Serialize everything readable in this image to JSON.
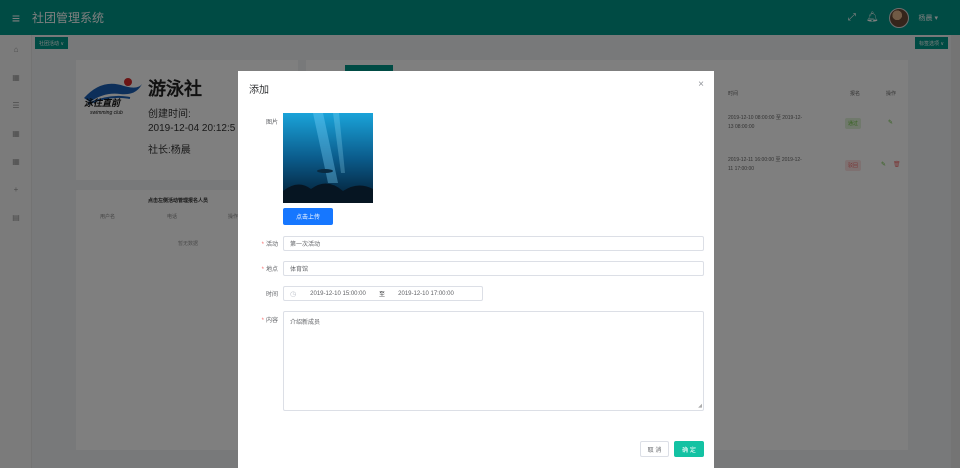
{
  "header": {
    "app_title": "社团管理系统",
    "user_name": "杨晨",
    "user_caret": "▾"
  },
  "tabs": {
    "left_tab": "社团活动 ∨",
    "right_tab": "标签选项 ∨"
  },
  "club": {
    "name": "游泳社",
    "created_label": "创建时间:",
    "created_value": "2019-12-04 20:12:5",
    "leader": "社长:杨晨",
    "logo_text": "泳往直前",
    "logo_sub": "swimming club"
  },
  "member_panel": {
    "title": "点击左侧活动管理报名人员",
    "columns": [
      "用户名",
      "电话",
      "操作"
    ],
    "empty_text": "暂无数据"
  },
  "activity_table": {
    "columns": [
      "时间",
      "报名",
      "操作"
    ],
    "rows": [
      {
        "time": "2019-12-10 08:00:00 至 2019-12-13 08:00:00",
        "status": "通过"
      },
      {
        "time": "2019-12-11 16:00:00 至 2019-12-11 17:00:00",
        "status": "驳回"
      }
    ]
  },
  "dialog": {
    "title": "添加",
    "close": "×",
    "image_label": "图片",
    "upload_button": "点击上传",
    "activity_label": "活动",
    "activity_value": "第一次活动",
    "place_label": "地点",
    "place_value": "体育馆",
    "time_label": "时间",
    "time_start": "2019-12-10 15:00:00",
    "time_sep": "至",
    "time_end": "2019-12-10 17:00:00",
    "content_label": "内容",
    "content_value": "介绍新成员",
    "cancel_button": "取 消",
    "confirm_button": "确 定",
    "required_mark": "*"
  },
  "colors": {
    "primary": "#009688",
    "upload": "#1677ff",
    "confirm": "#13c2a3",
    "required": "#f56c6c"
  }
}
